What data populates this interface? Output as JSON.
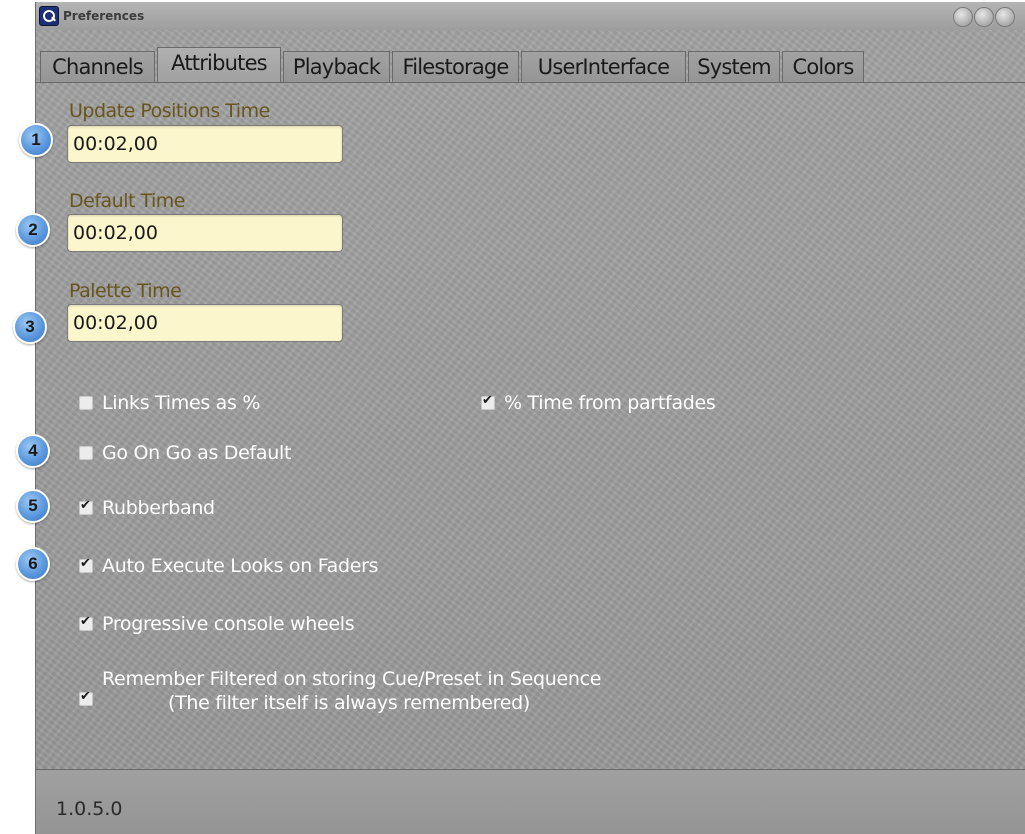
{
  "window": {
    "title": "Preferences"
  },
  "tabs": [
    "Channels",
    "Attributes",
    "Playback",
    "Filestorage",
    "UserInterface",
    "System",
    "Colors"
  ],
  "active_tab": "Attributes",
  "fields": [
    {
      "label": "Update Positions Time",
      "value": "00:02,00"
    },
    {
      "label": "Default Time",
      "value": "00:02,00"
    },
    {
      "label": "Palette Time",
      "value": "00:02,00"
    }
  ],
  "options": {
    "links_times": {
      "label": "Links Times as %",
      "checked": false
    },
    "pct_time_partfades": {
      "label": "% Time from partfades",
      "checked": true
    },
    "go_on_go": {
      "label": "Go On Go as Default",
      "checked": false
    },
    "rubberband": {
      "label": "Rubberband",
      "checked": true
    },
    "auto_execute": {
      "label": "Auto Execute Looks on Faders",
      "checked": true
    },
    "progressive_wheels": {
      "label": "Progressive console wheels",
      "checked": true
    },
    "remember_filtered": {
      "label_line1": "Remember Filtered on storing Cue/Preset in Sequence",
      "label_line2": "(The filter itself is always remembered)",
      "checked": true
    }
  },
  "markers": [
    "1",
    "2",
    "3",
    "4",
    "5",
    "6"
  ],
  "status": {
    "version": "1.0.5.0"
  },
  "colors": {
    "field_bg": "#fbf6cc",
    "label_text": "#68551d",
    "marker_blue": "#5b98de"
  }
}
